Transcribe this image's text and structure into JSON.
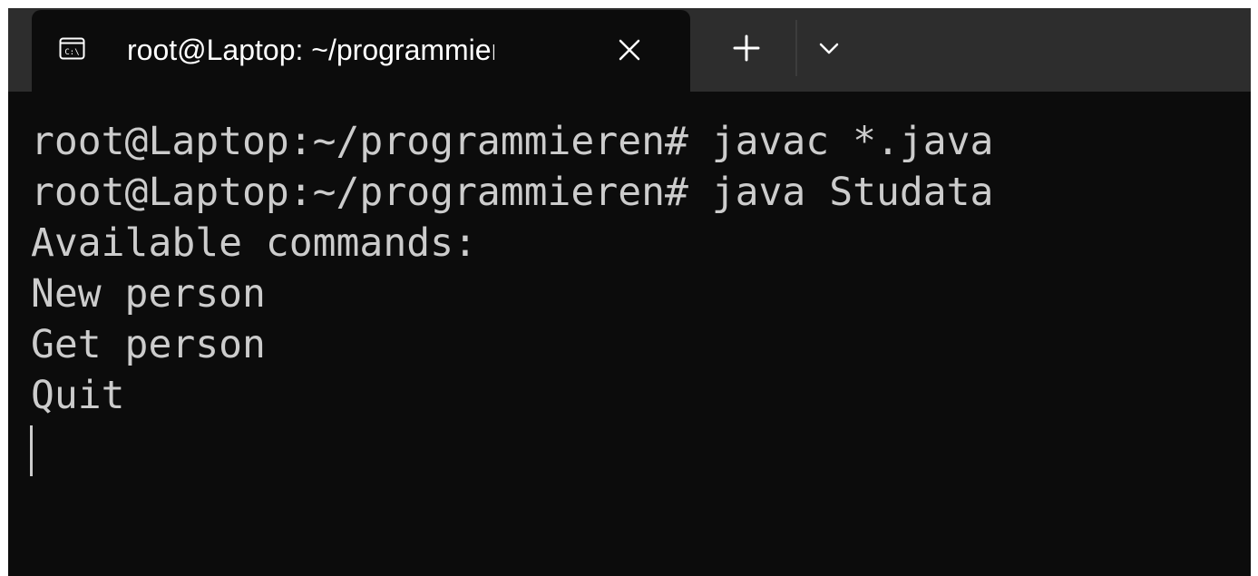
{
  "tab": {
    "icon": "terminal-icon",
    "title": "root@Laptop: ~/programmieren",
    "close_icon": "close-icon"
  },
  "titlebar": {
    "new_tab_icon": "plus-icon",
    "dropdown_icon": "chevron-down-icon"
  },
  "terminal": {
    "lines": [
      "root@Laptop:~/programmieren# javac *.java",
      "root@Laptop:~/programmieren# java Studata",
      "Available commands:",
      "New person",
      "Get person",
      "Quit"
    ]
  },
  "colors": {
    "terminal_background": "#0c0c0c",
    "titlebar_background": "#2d2d2d",
    "text": "#cccccc"
  }
}
